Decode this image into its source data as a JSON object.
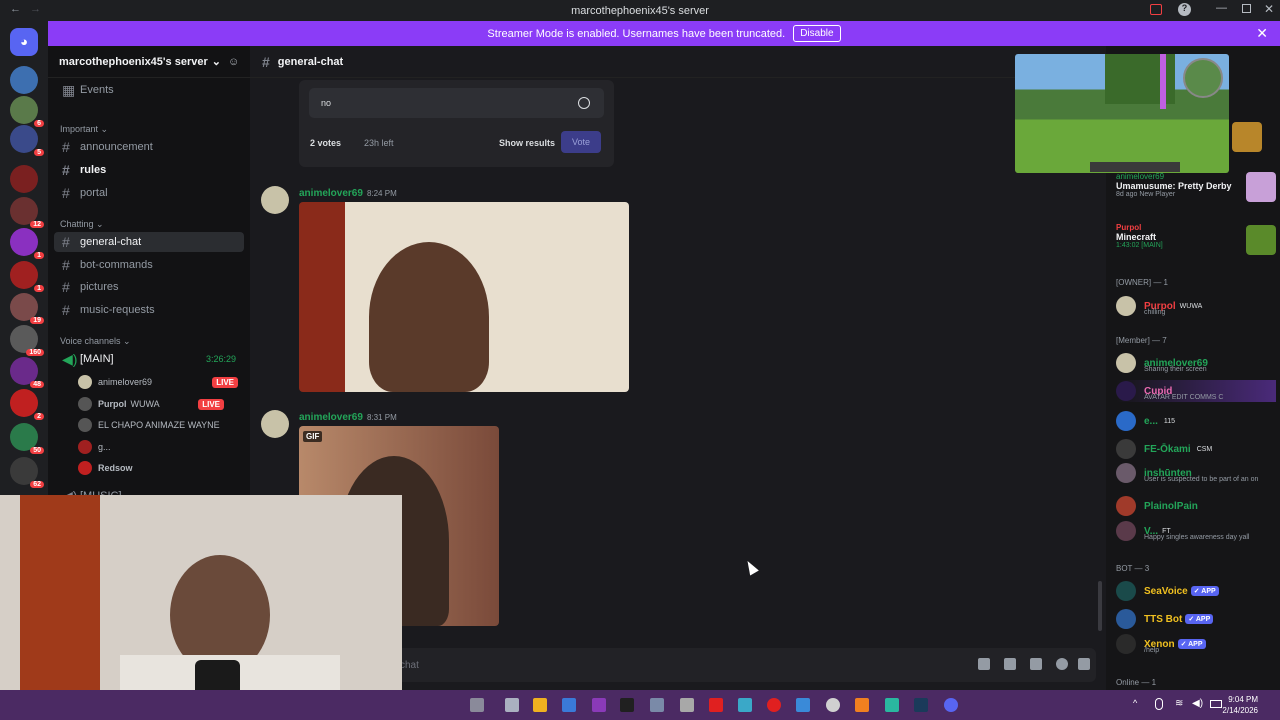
{
  "titlebar": {
    "title": "marcothephoenix45's server"
  },
  "banner": {
    "text": "Streamer Mode is enabled. Usernames have been truncated.",
    "button": "Disable"
  },
  "server": {
    "name": "marcothephoenix45's server"
  },
  "channels": {
    "events": "Events",
    "cat_important": "Important",
    "announcement": "announcement",
    "rules": "rules",
    "portal": "portal",
    "cat_chatting": "Chatting",
    "general": "general-chat",
    "bot": "bot-commands",
    "pictures": "pictures",
    "music": "music-requests",
    "cat_voice": "Voice channels",
    "main": "[MAIN]",
    "main_time": "3:26:29",
    "voice_users": [
      "animelover69",
      "Purpol",
      "EL CHAPO ANIMAZE WAYNE",
      "g...",
      "Redsow"
    ],
    "voice_tag": "WUWA",
    "live": "LIVE",
    "music_vc": "[MUSIC]"
  },
  "chat": {
    "channel": "general-chat",
    "poll_option": "no",
    "poll_votes": "2 votes",
    "poll_left": "23h left",
    "show_results": "Show results",
    "vote": "Vote",
    "msg1_user": "animelover69",
    "msg1_time": "8:24 PM",
    "msg2_user": "animelover69",
    "msg2_time": "8:31 PM",
    "gif": "GIF",
    "composer": "chat"
  },
  "members": {
    "act1_user": "animelover69",
    "act1_game": "Umamusume: Pretty Derby",
    "act1_sub": "8d ago  New Player",
    "act2_user": "Purpol",
    "act2_game": "Minecraft",
    "act2_sub": "1:43:02  [MAIN]",
    "owner_hdr": "[OWNER] — 1",
    "owner_name": "Purpol",
    "owner_tag": "WUWA",
    "owner_sub": "chilling",
    "member_hdr": "[Member] — 7",
    "m1": "animelover69",
    "m1_sub": "Sharing their screen",
    "m2": "Cupid",
    "m2_sub": "AVATAR EDIT COMMS C",
    "m3": "e...",
    "m3_tag": "115",
    "m4": "FE-Ōkami",
    "m4_tag": "CSM",
    "m5": "inshūnten",
    "m5_sub": "User is suspected to be part of an on",
    "m6": "PlainolPain",
    "m7": "V...",
    "m7_tag": "FT",
    "m7_sub": "Happy singles awareness day yall",
    "bot_hdr": "BOT — 3",
    "b1": "SeaVoice",
    "b2": "TTS Bot",
    "b3": "Xenon",
    "b3_sub": "/help",
    "app": "✓ APP",
    "online_hdr": "Online — 1"
  },
  "taskbar": {
    "time": "9:04 PM",
    "date": "2/14/2026"
  },
  "colors": {
    "accent": "#8b3cf7",
    "online": "#23a559",
    "live": "#f23f42",
    "app": "#5865f2"
  }
}
